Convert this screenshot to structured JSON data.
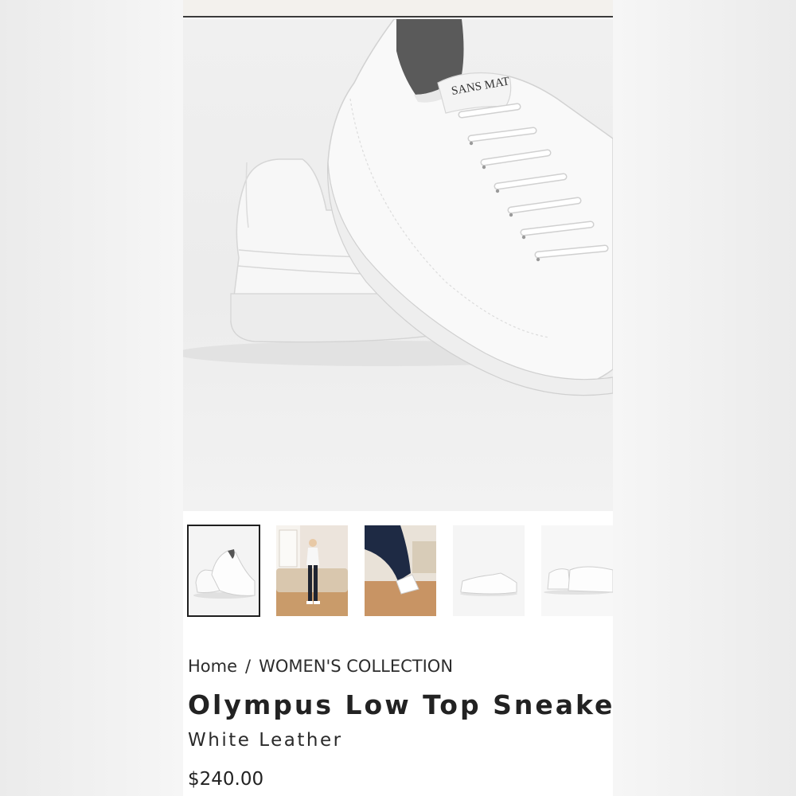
{
  "product": {
    "brand_mark": "SANS MAT",
    "title": "Olympus Low Top Sneakers",
    "subtitle": "White Leather",
    "price": "$240.00"
  },
  "breadcrumb": {
    "home": "Home",
    "separator": "/",
    "collection": "WOMEN'S COLLECTION"
  },
  "gallery": {
    "thumbnails": [
      {
        "subject": "sneaker-pair-studio",
        "selected": true
      },
      {
        "subject": "model-standing-living-room",
        "selected": false
      },
      {
        "subject": "model-seated-sneaker-closeup",
        "selected": false
      },
      {
        "subject": "single-sneaker-side",
        "selected": false
      },
      {
        "subject": "sneaker-pair-back",
        "selected": false
      }
    ]
  },
  "colors": {
    "text": "#222222",
    "topbar": "#f3f1ed",
    "thumb_selected_border": "#1f1f1f"
  }
}
